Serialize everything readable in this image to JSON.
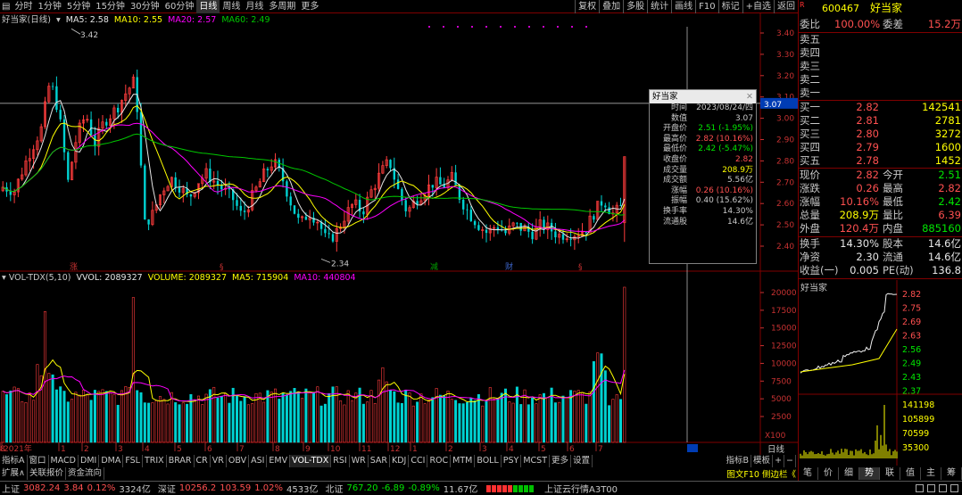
{
  "toolbar": {
    "items": [
      "分时",
      "1分钟",
      "5分钟",
      "15分钟",
      "30分钟",
      "60分钟",
      "日线",
      "周线",
      "月线",
      "多周期",
      "更多"
    ],
    "active": "日线",
    "right_items": [
      "复权",
      "叠加",
      "多股",
      "统计",
      "画线",
      "F10",
      "标记",
      "+自选",
      "返回"
    ]
  },
  "header": {
    "name": "好当家(日线)",
    "ma5": "MA5: 2.58",
    "ma10": "MA10: 2.55",
    "ma20": "MA20: 2.57",
    "ma60": "MA60: 2.49",
    "vol_name": "VOL-TDX(5,10)",
    "vvol": "VVOL: 2089327",
    "volume": "VOLUME: 2089327",
    "vol_ma5": "MA5: 715904",
    "vol_ma10": "MA10: 440804"
  },
  "price_axis": [
    "3.40",
    "3.30",
    "3.20",
    "3.10",
    "3.00",
    "2.90",
    "2.80",
    "2.70",
    "2.60",
    "2.50",
    "2.40"
  ],
  "cursor_price": "3.07",
  "vol_axis": [
    "20000",
    "17500",
    "15000",
    "12500",
    "10000",
    "7500",
    "5000",
    "2500"
  ],
  "vol_unit": "X100",
  "high_label": "3.42",
  "low_label": "2.34",
  "month_axis": [
    "2021年",
    "1",
    "2",
    "3",
    "4",
    "5",
    "6",
    "7",
    "8",
    "9",
    "10",
    "11",
    "12",
    "1",
    "2",
    "3",
    "4",
    "5",
    "6",
    "7",
    "8"
  ],
  "event_marks": [
    {
      "label": "涨",
      "color": "#c83232"
    },
    {
      "label": "§",
      "color": "#c83232"
    },
    {
      "label": "减",
      "color": "#00a000"
    },
    {
      "label": "财",
      "color": "#3c64c8"
    },
    {
      "label": "§",
      "color": "#c83232"
    }
  ],
  "tooltip": {
    "title": "好当家",
    "rows": [
      {
        "k": "时间",
        "v": "2023/08/24/四",
        "c": "#c8c8c8"
      },
      {
        "k": "数值",
        "v": "3.07",
        "c": "#c8c8c8"
      },
      {
        "k": "开盘价",
        "v": "2.51 (-1.95%)",
        "c": "#00e600"
      },
      {
        "k": "最高价",
        "v": "2.82 (10.16%)",
        "c": "#ff5050"
      },
      {
        "k": "最低价",
        "v": "2.42 (-5.47%)",
        "c": "#00e600"
      },
      {
        "k": "收盘价",
        "v": "2.82",
        "c": "#ff5050"
      },
      {
        "k": "成交量",
        "v": "208.9万",
        "c": "#ffff00"
      },
      {
        "k": "成交额",
        "v": "5.56亿",
        "c": "#c8c8c8"
      },
      {
        "k": "涨幅",
        "v": "0.26 (10.16%)",
        "c": "#ff5050"
      },
      {
        "k": "振幅",
        "v": "0.40 (15.62%)",
        "c": "#c8c8c8"
      },
      {
        "k": "换手率",
        "v": "14.30%",
        "c": "#c8c8c8"
      },
      {
        "k": "流通股",
        "v": "14.6亿",
        "c": "#c8c8c8"
      }
    ]
  },
  "quote": {
    "code": "600467",
    "name": "好当家",
    "weibi_label": "委比",
    "weibi": "100.00%",
    "weicha_label": "委差",
    "weicha": "15.2万",
    "sell": [
      {
        "label": "卖五"
      },
      {
        "label": "卖四"
      },
      {
        "label": "卖三"
      },
      {
        "label": "卖二"
      },
      {
        "label": "卖一"
      }
    ],
    "buy": [
      {
        "label": "买一",
        "price": "2.82",
        "vol": "142541"
      },
      {
        "label": "买二",
        "price": "2.81",
        "vol": "2781"
      },
      {
        "label": "买三",
        "price": "2.80",
        "vol": "3272"
      },
      {
        "label": "买四",
        "price": "2.79",
        "vol": "1600"
      },
      {
        "label": "买五",
        "price": "2.78",
        "vol": "1452"
      }
    ],
    "stats": [
      {
        "l1": "现价",
        "v1": "2.82",
        "c1": "#ff5050",
        "l2": "今开",
        "v2": "2.51",
        "c2": "#00e600"
      },
      {
        "l1": "涨跌",
        "v1": "0.26",
        "c1": "#ff5050",
        "l2": "最高",
        "v2": "2.82",
        "c2": "#ff5050"
      },
      {
        "l1": "涨幅",
        "v1": "10.16%",
        "c1": "#ff5050",
        "l2": "最低",
        "v2": "2.42",
        "c2": "#00e600"
      },
      {
        "l1": "总量",
        "v1": "208.9万",
        "c1": "#ffff00",
        "l2": "量比",
        "v2": "6.39",
        "c2": "#ff5050"
      },
      {
        "l1": "外盘",
        "v1": "120.4万",
        "c1": "#ff5050",
        "l2": "内盘",
        "v2": "885160",
        "c2": "#00e600"
      }
    ],
    "stats2": [
      {
        "l1": "换手",
        "v1": "14.30%",
        "l2": "股本",
        "v2": "14.6亿"
      },
      {
        "l1": "净资",
        "v1": "2.30",
        "l2": "流通",
        "v2": "14.6亿"
      },
      {
        "l1": "收益(一)",
        "v1": "0.005",
        "l2": "PE(动)",
        "v2": "136.8"
      }
    ]
  },
  "mini_chart": {
    "title": "好当家",
    "price_ticks": [
      "2.82",
      "2.75",
      "2.69",
      "2.63",
      "2.56",
      "2.49",
      "2.43",
      "2.37"
    ],
    "vol_ticks": [
      "141198",
      "105899",
      "70599",
      "35300"
    ]
  },
  "indicator_tabs": [
    "指标A",
    "窗口",
    "MACD",
    "DMI",
    "DMA",
    "FSL",
    "TRIX",
    "BRAR",
    "CR",
    "VR",
    "OBV",
    "ASI",
    "EMV",
    "VOL-TDX",
    "RSI",
    "WR",
    "SAR",
    "KDJ",
    "CCI",
    "ROC",
    "MTM",
    "BOLL",
    "PSY",
    "MCST",
    "更多",
    "设置"
  ],
  "active_indicator": "VOL-TDX",
  "indicator_right": [
    "指标B",
    "模板",
    "+",
    "−"
  ],
  "tabs2": [
    "扩展∧",
    "关联报价",
    "资金流向"
  ],
  "tabs2_right": "图文F10 侧边栏《",
  "timeframe_label": "日线",
  "rp_tabs": [
    "笔",
    "价",
    "细",
    "势",
    "联",
    "值",
    "主",
    "筹"
  ],
  "rp_tab_active": "势",
  "status": {
    "sh_label": "上证",
    "sh_val": "3082.24",
    "sh_chg": "3.84",
    "sh_pct": "0.12%",
    "sh_amt": "3324亿",
    "sz_label": "深证",
    "sz_val": "10256.2",
    "sz_chg": "103.59",
    "sz_pct": "1.02%",
    "sz_amt": "4533亿",
    "bz_label": "北证",
    "bz_val": "767.20",
    "bz_chg": "-6.89",
    "bz_pct": "-0.89%",
    "bz_amt": "11.67亿",
    "source": "上证云行情A3T00"
  },
  "colors": {
    "up": "#ff5050",
    "down": "#00c8c8",
    "ma5": "#e6e6e6",
    "ma10": "#ffff00",
    "ma20": "#ff00ff",
    "ma60": "#00c800",
    "border": "#800000"
  }
}
